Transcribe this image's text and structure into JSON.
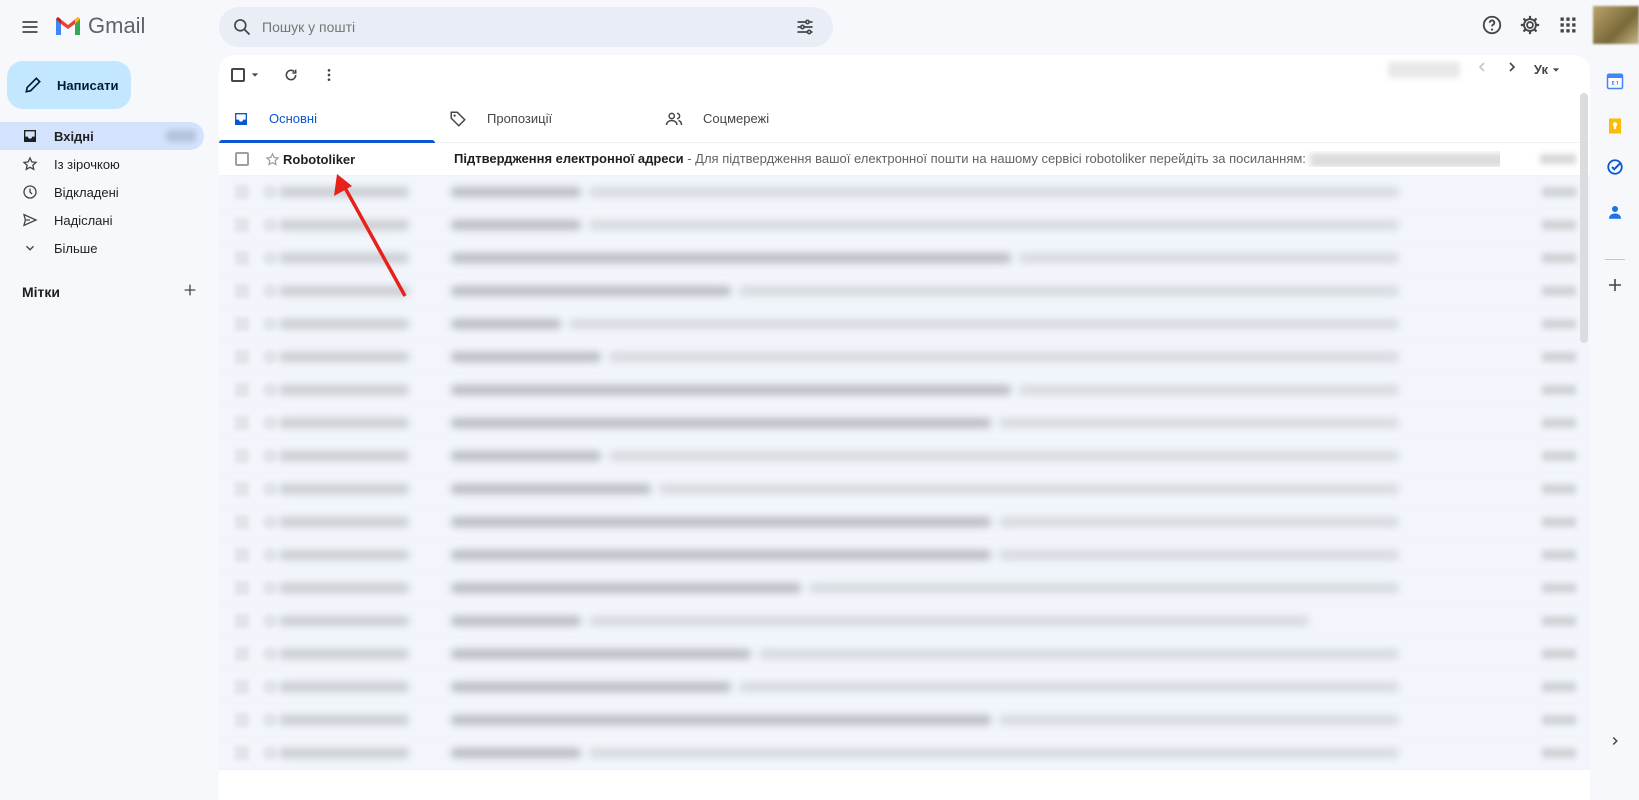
{
  "app": {
    "name": "Gmail"
  },
  "search": {
    "placeholder": "Пошук у пошті"
  },
  "compose": {
    "label": "Написати"
  },
  "nav": [
    {
      "label": "Вхідні",
      "icon": "inbox-icon",
      "active": true
    },
    {
      "label": "Із зірочкою",
      "icon": "star-icon"
    },
    {
      "label": "Відкладені",
      "icon": "clock-icon"
    },
    {
      "label": "Надіслані",
      "icon": "send-icon"
    },
    {
      "label": "Більше",
      "icon": "chevron-down-icon"
    }
  ],
  "labels": {
    "title": "Мітки"
  },
  "toolbar": {
    "language": "Ук"
  },
  "tabs": [
    {
      "label": "Основні",
      "icon": "inbox-icon",
      "active": true
    },
    {
      "label": "Пропозиції",
      "icon": "tag-icon"
    },
    {
      "label": "Соцмережі",
      "icon": "people-icon"
    }
  ],
  "emails": [
    {
      "sender": "Robotoliker",
      "subject": "Підтвердження електронної адреси",
      "snippet": " - Для підтвердження вашої електронної пошти на нашому сервісі robotoliker перейдіть за посиланням:"
    }
  ],
  "colors": {
    "accent": "#0b57d0",
    "compose_bg": "#c2e7ff",
    "nav_active": "#d3e3fd",
    "annotation_arrow": "#e8201a"
  }
}
